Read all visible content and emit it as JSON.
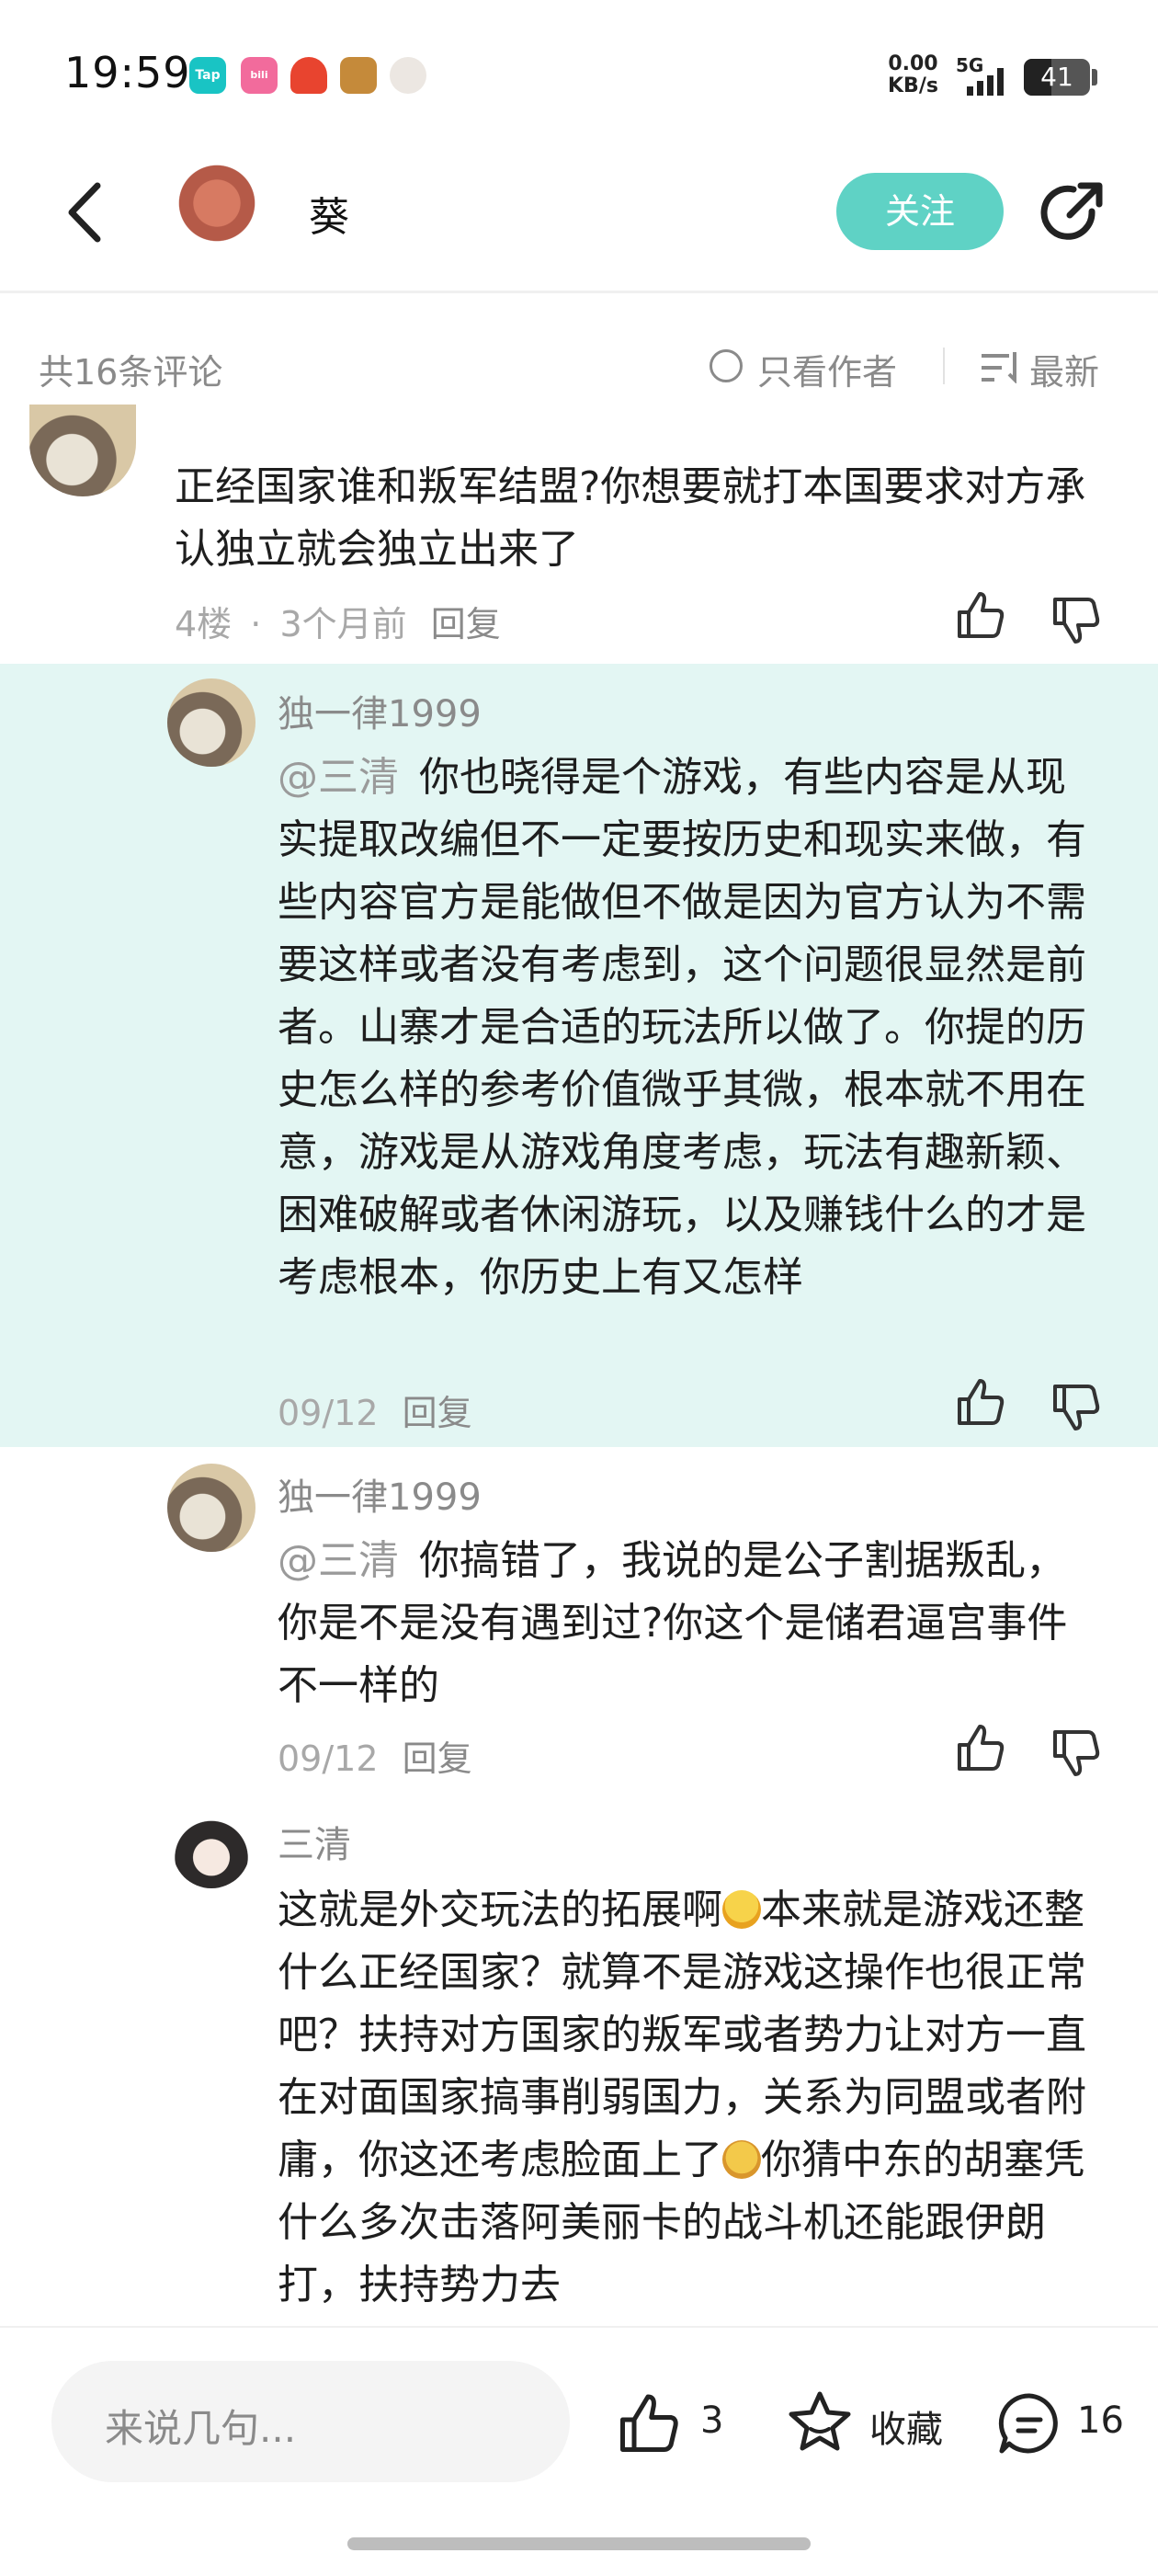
{
  "status_bar": {
    "time": "19:59",
    "apps": [
      "Tap",
      "bilibili",
      "game",
      "hero",
      "avatar"
    ],
    "net_speed_value": "0.00",
    "net_speed_unit": "KB/s",
    "network": "5G",
    "battery": "41",
    "battery_level": 0.41
  },
  "header": {
    "title": "葵",
    "follow_label": "关注",
    "colors": {
      "accent": "#5fd2c5"
    }
  },
  "comments_header": {
    "count": "共16条评论",
    "only_author": "只看作者",
    "sort": "最新"
  },
  "comments": [
    {
      "text": "正经国家谁和叛军结盟?你想要就打本国要求对方承认独立就会独立出来了",
      "floor": "4楼",
      "time": "3个月前",
      "reply_label": "回复"
    },
    {
      "user": "独一律1999",
      "mention": "@三清",
      "text": "你也晓得是个游戏，有些内容是从现实提取改编但不一定要按历史和现实来做，有些内容官方是能做但不做是因为官方认为不需要这样或者没有考虑到，这个问题很显然是前者。山寨才是合适的玩法所以做了。你提的历史怎么样的参考价值微乎其微，根本就不用在意，游戏是从游戏角度考虑，玩法有趣新颖、困难破解或者休闲游玩，以及赚钱什么的才是考虑根本，你历史上有又怎样",
      "time": "09/12",
      "reply_label": "回复",
      "highlighted": true
    },
    {
      "user": "独一律1999",
      "mention": "@三清",
      "text": "你搞错了，我说的是公子割据叛乱，你是不是没有遇到过?你这个是储君逼宫事件不一样的",
      "time": "09/12",
      "reply_label": "回复"
    },
    {
      "user": "三清",
      "text_part1": "这就是外交玩法的拓展啊",
      "text_part2": "本来就是游戏还整什么正经国家？就算不是游戏这操作也很正常吧？扶持对方国家的叛军或者势力让对方一直在对面国家搞事削弱国力，关系为同盟或者附庸，你这还考虑脸面上了",
      "text_part3": "你猜中东的胡塞凭什么多次击落阿美丽卡的战斗机还能跟伊朗打，扶持势力去"
    }
  ],
  "bottom_bar": {
    "input_placeholder": "来说几句...",
    "like_count": "3",
    "favorite_label": "收藏",
    "comment_count": "16"
  }
}
